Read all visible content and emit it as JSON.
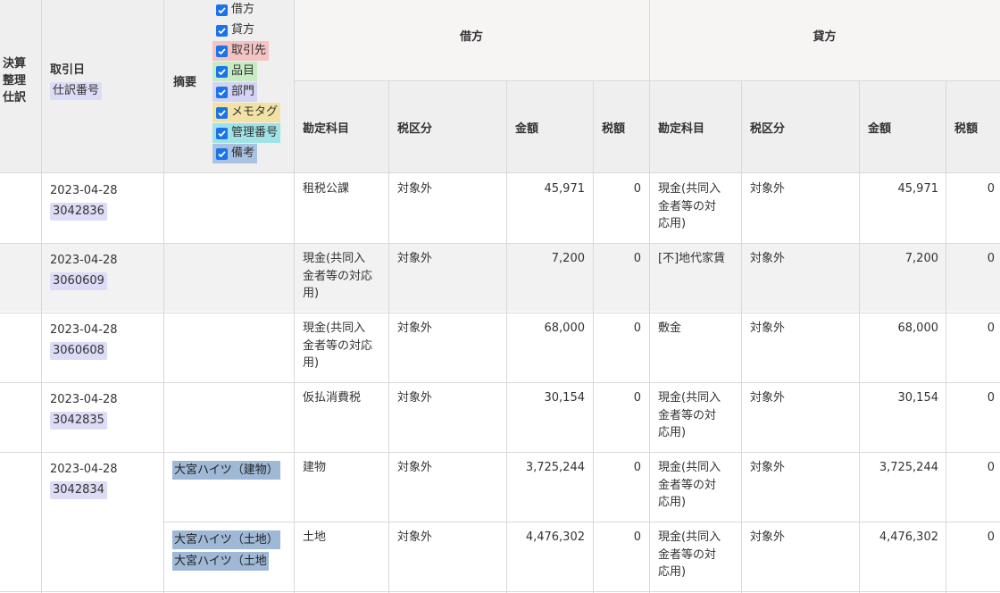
{
  "header": {
    "kessan_lines": [
      "決算",
      "整理",
      "仕訳"
    ],
    "date": "取引日",
    "journal_no": "仕訳番号",
    "tekiyo": "摘要",
    "debit": "借方",
    "credit": "貸方",
    "sub": {
      "account": "勘定科目",
      "tax_class": "税区分",
      "amount": "金額",
      "tax": "税額"
    },
    "filters": [
      {
        "label": "借方",
        "checked": true,
        "color": "transparent"
      },
      {
        "label": "貸方",
        "checked": true,
        "color": "transparent"
      },
      {
        "label": "取引先",
        "checked": true,
        "color": "#f4c3c3"
      },
      {
        "label": "品目",
        "checked": true,
        "color": "#c7ecc3"
      },
      {
        "label": "部門",
        "checked": true,
        "color": "#d3d3f5"
      },
      {
        "label": "メモタグ",
        "checked": true,
        "color": "#f3e2a5"
      },
      {
        "label": "管理番号",
        "checked": true,
        "color": "#9fe3e6"
      },
      {
        "label": "備考",
        "checked": true,
        "color": "#a9c2e2"
      }
    ]
  },
  "rows": [
    {
      "date": "2023-04-28",
      "no": "3042836",
      "lines": [
        {
          "tags": [],
          "d_account": "租税公課",
          "d_tax_class": "対象外",
          "d_amount": "45,971",
          "d_tax": "0",
          "c_account": "現金(共同入\n金者等の対\n応用)",
          "c_tax_class": "対象外",
          "c_amount": "45,971",
          "c_tax": "0"
        }
      ]
    },
    {
      "date": "2023-04-28",
      "no": "3060609",
      "lines": [
        {
          "tags": [],
          "d_account": "現金(共同入\n金者等の対応\n用)",
          "d_tax_class": "対象外",
          "d_amount": "7,200",
          "d_tax": "0",
          "c_account": "[不]地代家賃",
          "c_tax_class": "対象外",
          "c_amount": "7,200",
          "c_tax": "0"
        }
      ]
    },
    {
      "date": "2023-04-28",
      "no": "3060608",
      "lines": [
        {
          "tags": [],
          "d_account": "現金(共同入\n金者等の対応\n用)",
          "d_tax_class": "対象外",
          "d_amount": "68,000",
          "d_tax": "0",
          "c_account": "敷金",
          "c_tax_class": "対象外",
          "c_amount": "68,000",
          "c_tax": "0"
        }
      ]
    },
    {
      "date": "2023-04-28",
      "no": "3042835",
      "lines": [
        {
          "tags": [],
          "d_account": "仮払消費税",
          "d_tax_class": "対象外",
          "d_amount": "30,154",
          "d_tax": "0",
          "c_account": "現金(共同入\n金者等の対\n応用)",
          "c_tax_class": "対象外",
          "c_amount": "30,154",
          "c_tax": "0"
        }
      ]
    },
    {
      "date": "2023-04-28",
      "no": "3042834",
      "lines": [
        {
          "tags": [
            "大宮ハイツ（建物）"
          ],
          "d_account": "建物",
          "d_tax_class": "対象外",
          "d_amount": "3,725,244",
          "d_tax": "0",
          "c_account": "現金(共同入\n金者等の対\n応用)",
          "c_tax_class": "対象外",
          "c_amount": "3,725,244",
          "c_tax": "0"
        },
        {
          "tags": [
            "大宮ハイツ（土地）",
            "大宮ハイツ（土地"
          ],
          "d_account": "土地",
          "d_tax_class": "対象外",
          "d_amount": "4,476,302",
          "d_tax": "0",
          "c_account": "現金(共同入\n金者等の対\n応用)",
          "c_tax_class": "対象外",
          "c_amount": "4,476,302",
          "c_tax": "0"
        }
      ]
    }
  ]
}
